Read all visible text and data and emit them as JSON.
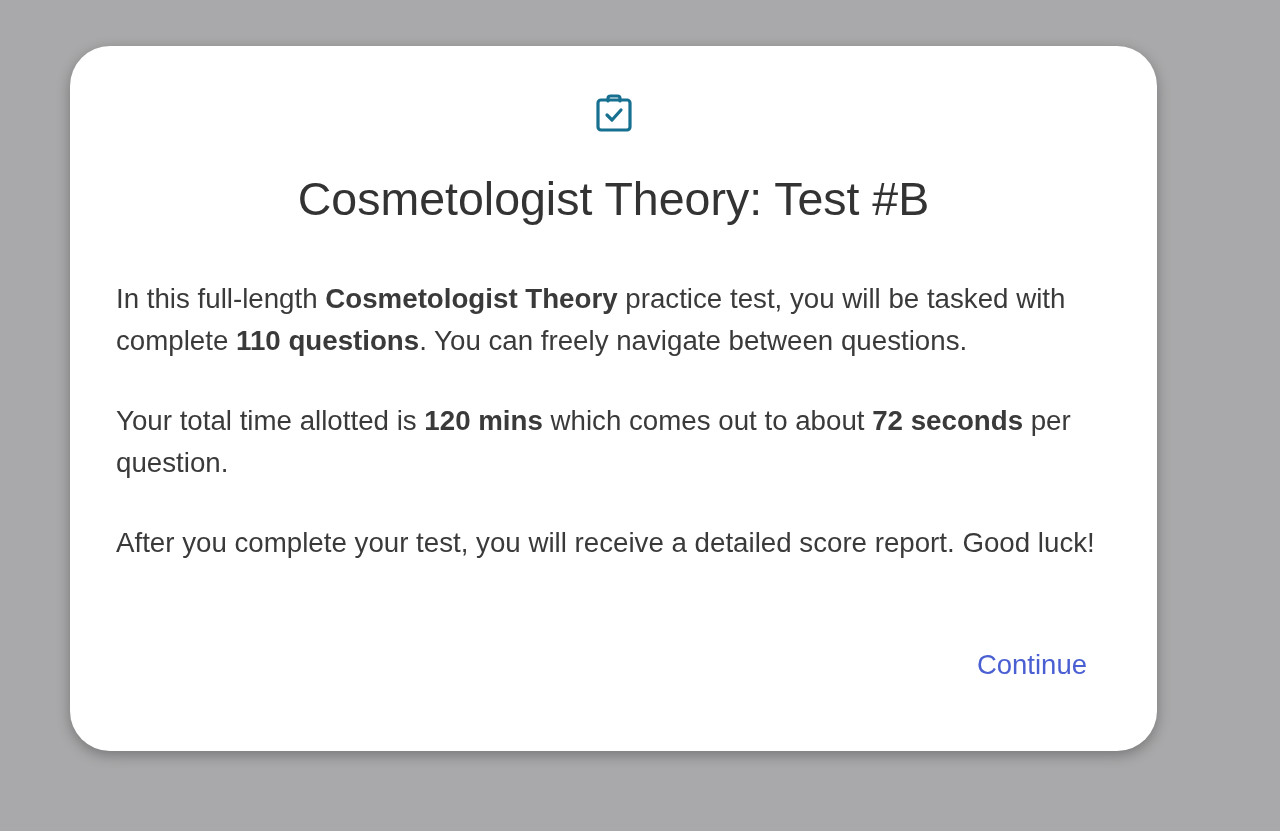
{
  "dialog": {
    "title": "Cosmetologist Theory: Test #B",
    "paragraphs": [
      "In this full-length **Cosmetologist Theory** practice test, you will be tasked with complete **110 questions**. You can freely navigate between questions.",
      "Your total time allotted is **120 mins** which comes out to about **72 seconds** per question.",
      "After you complete your test, you will receive a detailed score report. Good luck!"
    ],
    "continue_button": "Continue"
  }
}
